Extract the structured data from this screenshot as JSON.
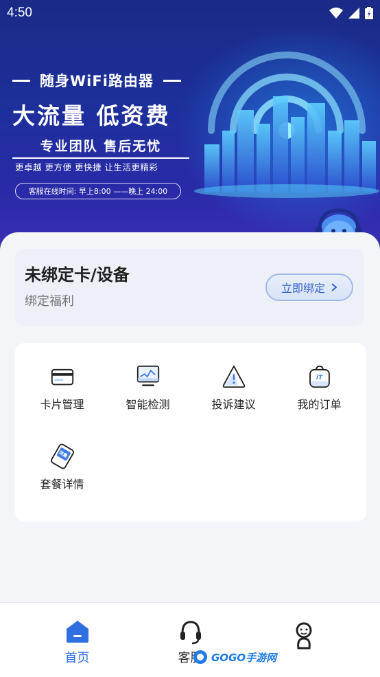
{
  "status_bar": {
    "time": "4:50"
  },
  "banner": {
    "headline_product": "随身WiFi路由器",
    "headline_main": "大流量  低资费",
    "headline_team": "专业团队  售后无忧",
    "headline_slogan": "更卓越  更方便  更快捷  让生活更精彩",
    "service_hours": "客服在线时间: 早上8:00 ——晚上 24:00"
  },
  "bind_card": {
    "title": "未绑定卡/设备",
    "subtitle": "绑定福利",
    "button_label": "立即绑定"
  },
  "features": [
    {
      "label": "卡片管理",
      "icon": "card-icon"
    },
    {
      "label": "智能检测",
      "icon": "monitor-icon"
    },
    {
      "label": "投诉建议",
      "icon": "warning-icon"
    },
    {
      "label": "我的订单",
      "icon": "bag-icon"
    },
    {
      "label": "套餐详情",
      "icon": "ticket-icon",
      "icon_text": "流量"
    }
  ],
  "bottom_nav": [
    {
      "label": "首页",
      "icon": "home-icon",
      "active": true
    },
    {
      "label": "客服",
      "icon": "headset-icon",
      "active": false
    },
    {
      "label": "",
      "icon": "profile-icon",
      "active": false
    }
  ],
  "watermark": {
    "text": "GOGO手游网"
  },
  "colors": {
    "accent": "#2f6fe0",
    "banner": "#1c2f9a"
  }
}
